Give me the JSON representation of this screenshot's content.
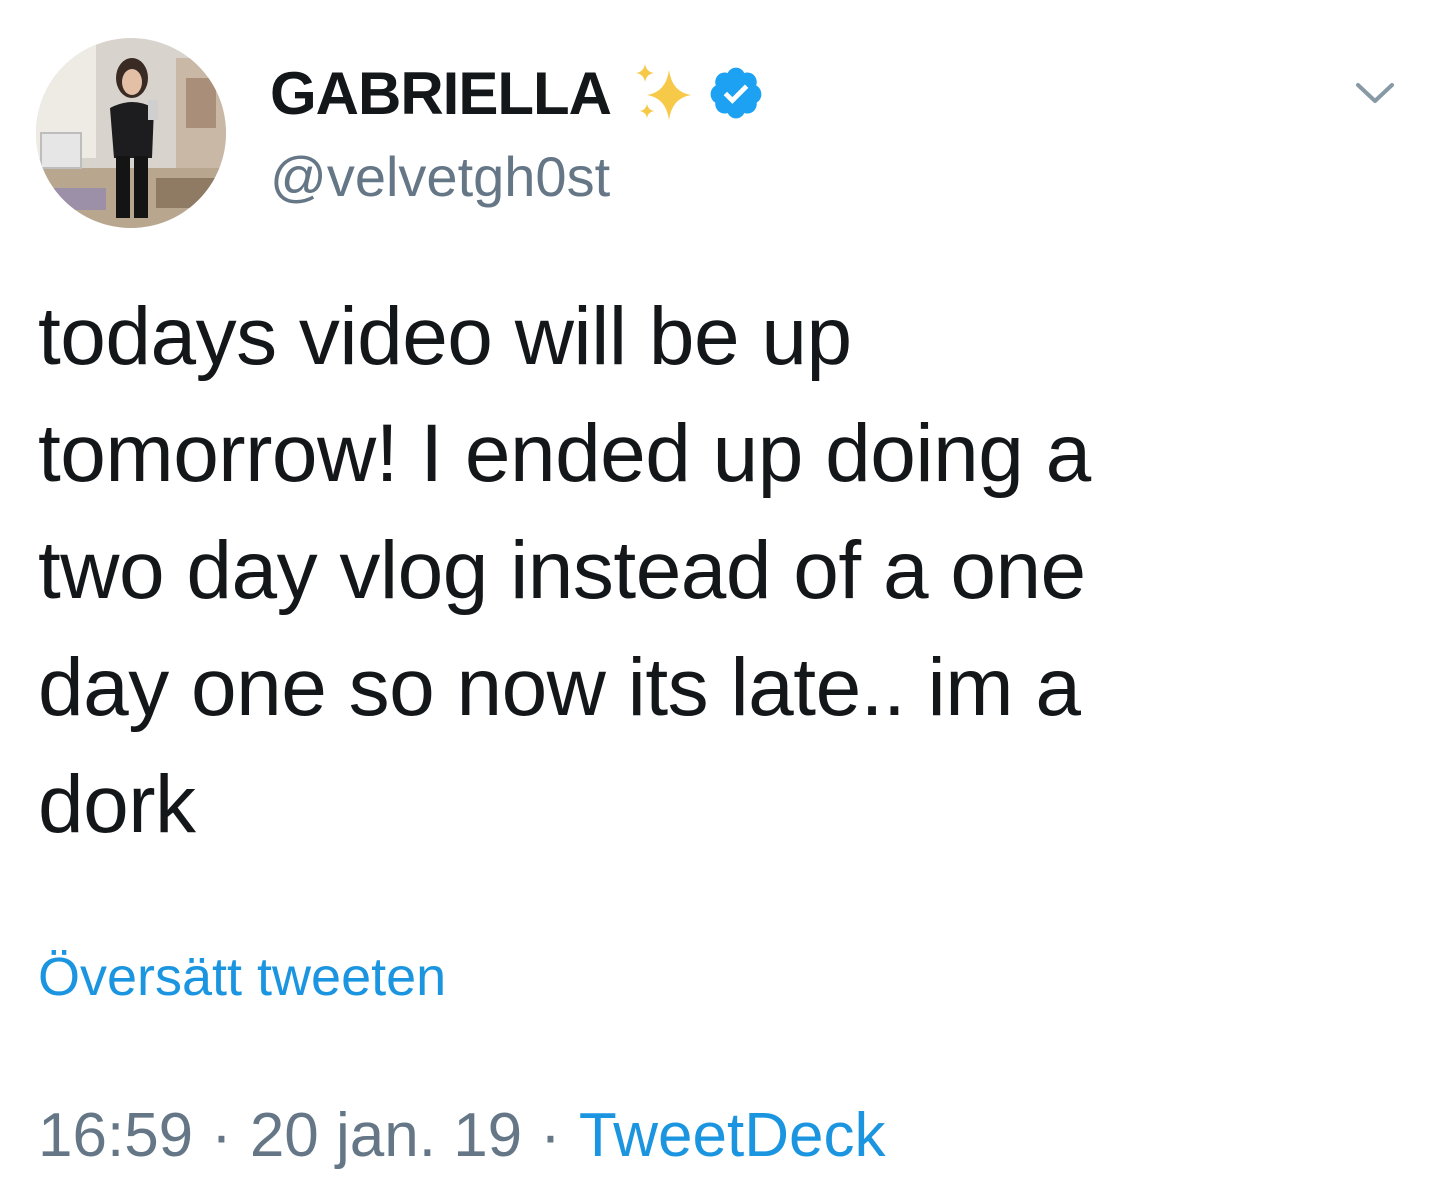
{
  "tweet": {
    "author": {
      "display_name": "GABRIELLA",
      "handle": "@velvetgh0st",
      "name_emoji_icon": "sparkles-icon",
      "verified_icon": "verified-badge-icon",
      "avatar_icon": "profile-photo"
    },
    "text": "todays video will be up\ntomorrow! I ended up doing a\ntwo day vlog instead of a one\nday one so now its late.. im a\ndork",
    "translate_label": "Översätt tweeten",
    "time": "16:59",
    "date": "20 jan. 19",
    "separator": "·",
    "source": "TweetDeck",
    "menu_icon": "chevron-down-icon"
  },
  "colors": {
    "text_primary": "#14171a",
    "text_secondary": "#657786",
    "link_blue": "#1b95e0",
    "verified_blue": "#1da1f2",
    "sparkle_gold": "#f7c948"
  }
}
